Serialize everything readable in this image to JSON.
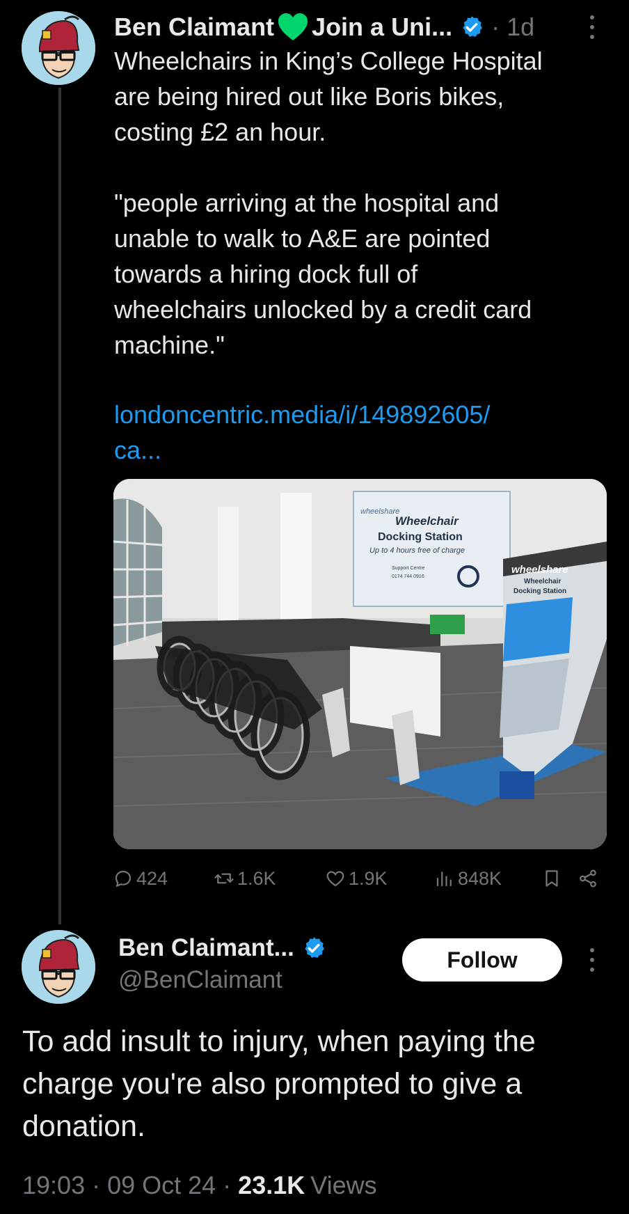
{
  "post1": {
    "author": "Ben Claimant",
    "author_suffix": "Join a Uni...",
    "time": "· 1d",
    "text": "Wheelchairs in King’s College Hospital\nare being hired out like Boris bikes,\ncosting £2 an hour.\n\n\"people arriving at the hospital and\nunable to walk to A&E are pointed\ntowards a hiring dock full of\nwheelchairs unlocked by a credit card\nmachine.\"",
    "link": "londoncentric.media/i/149892605/\nca...",
    "image_text": {
      "sign_brand": "wheelshare",
      "sign_title": "Wheelchair",
      "sign_title2": "Docking Station",
      "sign_free": "Up to 4 hours free of charge",
      "sign_support": "Support Centre",
      "sign_phone": "0174 744 0916",
      "kiosk_brand": "wheelshare",
      "kiosk_sub": "Wheelchair",
      "kiosk_sub2": "Docking Station"
    },
    "actions": {
      "replies": "424",
      "reposts": "1.6K",
      "likes": "1.9K",
      "views": "848K"
    }
  },
  "post2": {
    "author": "Ben Claimant...",
    "handle": "@BenClaimant",
    "follow_label": "Follow",
    "text": "To add insult to injury, when paying the charge you're also prompted to give a donation.",
    "timestamp": "19:03 · 09 Oct 24 ·",
    "views_count": "23.1K",
    "views_label": "Views"
  },
  "colors": {
    "background": "#000000",
    "text": "#e7e9ea",
    "muted": "#71767b",
    "link": "#1d9bf0",
    "verified": "#1d9bf0",
    "heart": "#00d56b"
  }
}
